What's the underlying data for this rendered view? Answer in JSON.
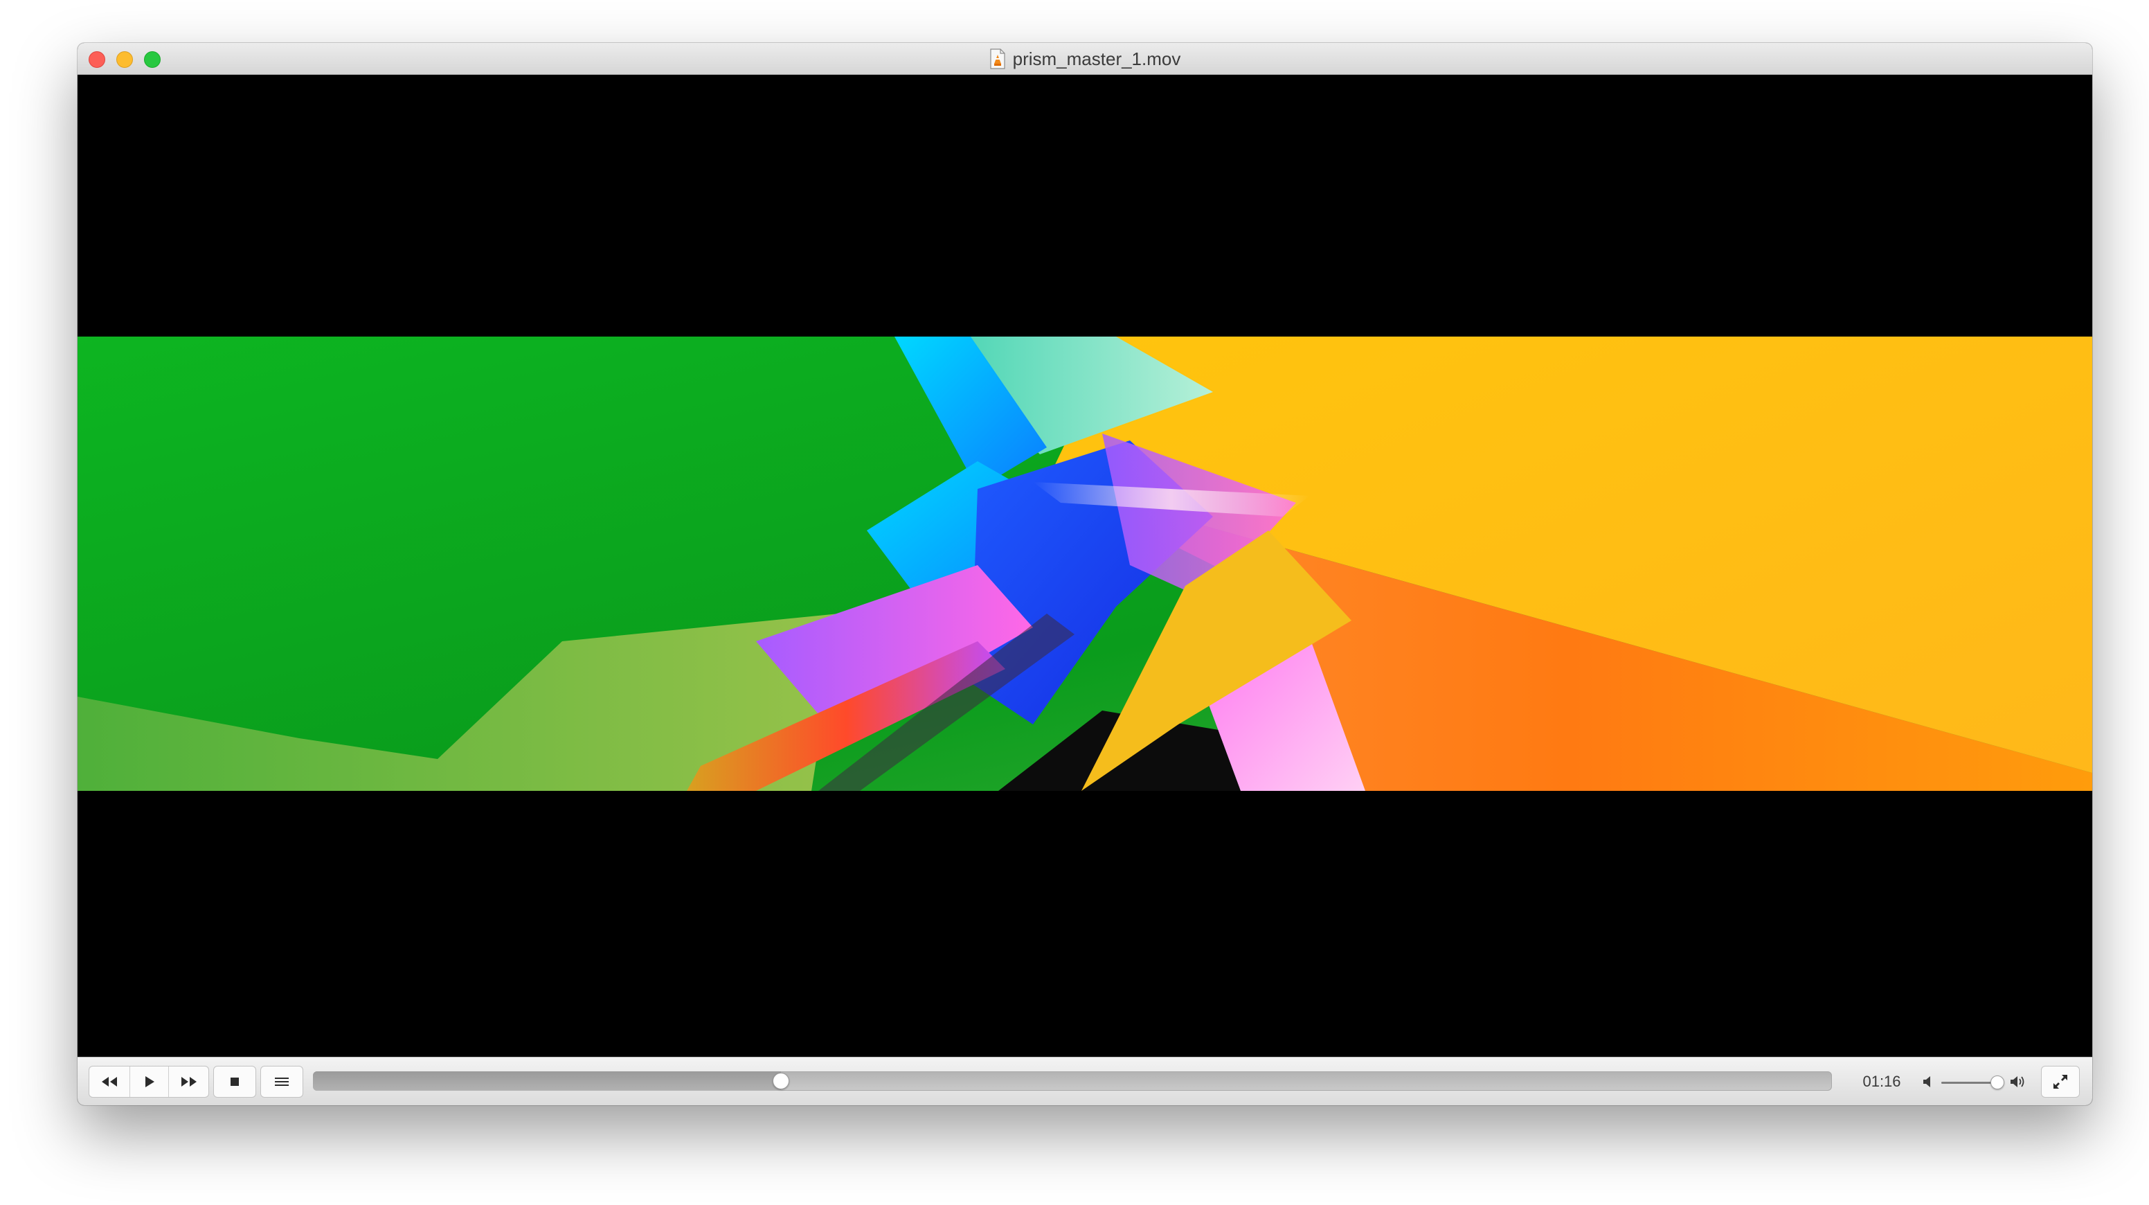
{
  "window": {
    "title": "prism_master_1.mov",
    "file_icon": "vlc-document-icon"
  },
  "traffic_lights": {
    "close_color": "#fc5f57",
    "minimize_color": "#fdbc2e",
    "maximize_color": "#28c840"
  },
  "video": {
    "letterbox_color": "#000000",
    "frame_palette": [
      "#0aa81a",
      "#00c8ff",
      "#1240ff",
      "#c35cff",
      "#ffc20e",
      "#ff7a10"
    ]
  },
  "controls": {
    "buttons": [
      {
        "name": "rewind-button",
        "icon": "rewind-icon"
      },
      {
        "name": "play-button",
        "icon": "play-icon"
      },
      {
        "name": "fast-forward-button",
        "icon": "fast-forward-icon"
      },
      {
        "name": "stop-button",
        "icon": "stop-icon"
      },
      {
        "name": "playlist-button",
        "icon": "playlist-icon"
      },
      {
        "name": "fullscreen-button",
        "icon": "fullscreen-icon"
      }
    ],
    "playback_position_fraction": 0.308,
    "time_display": "01:16",
    "volume_fraction": 0.92,
    "volume_low_icon": "speaker-low-icon",
    "volume_high_icon": "speaker-high-icon"
  }
}
